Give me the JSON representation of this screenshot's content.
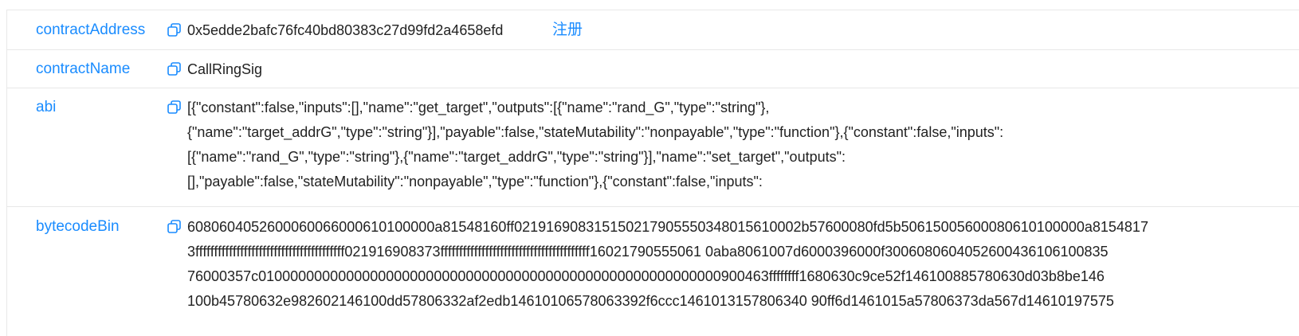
{
  "rows": {
    "contract_address": {
      "key": "contractAddress",
      "value": "0x5edde2bafc76fc40bd80383c27d99fd2a4658efd",
      "action": "注册"
    },
    "contract_name": {
      "key": "contractName",
      "value": "CallRingSig"
    },
    "abi": {
      "key": "abi",
      "lines": [
        "[{\"constant\":false,\"inputs\":[],\"name\":\"get_target\",\"outputs\":[{\"name\":\"rand_G\",\"type\":\"string\"},",
        "{\"name\":\"target_addrG\",\"type\":\"string\"}],\"payable\":false,\"stateMutability\":\"nonpayable\",\"type\":\"function\"},{\"constant\":false,\"inputs\":",
        "[{\"name\":\"rand_G\",\"type\":\"string\"},{\"name\":\"target_addrG\",\"type\":\"string\"}],\"name\":\"set_target\",\"outputs\":",
        "[],\"payable\":false,\"stateMutability\":\"nonpayable\",\"type\":\"function\"},{\"constant\":false,\"inputs\":"
      ]
    },
    "bytecode_bin": {
      "key": "bytecodeBin",
      "lines": [
        "6080604052600060066000610100000a81548160ff021916908315150217905550348015610002b57600080fd5b50615005600080610100000a8154817",
        "3ffffffffffffffffffffffffffffffffffffffff021916908373ffffffffffffffffffffffffffffffffffffffff16021790555061 0aba8061007d6000396000f3006080604052600436106100835",
        "76000357c0100000000000000000000000000000000000000000000000000000000900463ffffffff1680630c9ce52f146100885780630d03b8be146",
        "100b45780632e982602146100dd57806332af2edb14610106578063392f6ccc1461013157806340 90ff6d1461015a57806373da567d14610197575"
      ]
    }
  },
  "icons": {
    "copy": "copy-icon"
  },
  "colors": {
    "link": "#1a8cff",
    "border": "#e8e8e8",
    "text": "#222222"
  }
}
